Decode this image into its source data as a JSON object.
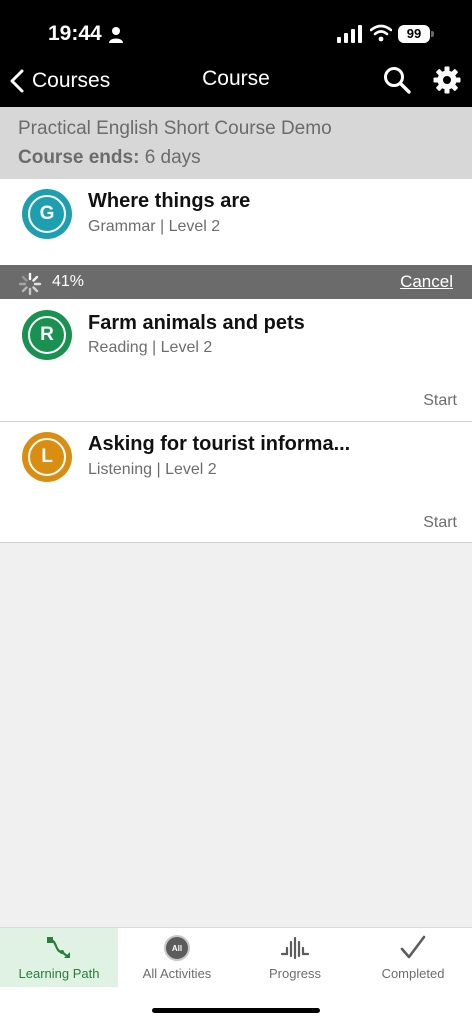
{
  "status_bar": {
    "time": "19:44",
    "battery": "99",
    "icons": [
      "person-icon",
      "signal-icon",
      "wifi-icon",
      "battery-icon"
    ]
  },
  "nav": {
    "back_label": "Courses",
    "title": "Course",
    "icons": [
      "chevron-left-icon",
      "search-icon",
      "gear-icon"
    ]
  },
  "course": {
    "name": "Practical English Short Course Demo",
    "ends_label": "Course ends:",
    "ends_value": "6 days"
  },
  "download": {
    "percent": "41%",
    "cancel_label": "Cancel"
  },
  "activities": [
    {
      "letter": "G",
      "title": "Where things are",
      "subtitle": "Grammar | Level 2",
      "action": "",
      "color": "#1e9fb0"
    },
    {
      "letter": "R",
      "title": "Farm animals and pets",
      "subtitle": "Reading | Level 2",
      "action": "Start",
      "color": "#1a9150"
    },
    {
      "letter": "L",
      "title": "Asking for tourist informa...",
      "subtitle": "Listening | Level 2",
      "action": "Start",
      "color": "#d98e12"
    }
  ],
  "tabs": [
    {
      "label": "Learning Path",
      "icon": "learning-path-icon",
      "active": true
    },
    {
      "label": "All Activities",
      "icon": "all-activities-icon",
      "badge": "All",
      "active": false
    },
    {
      "label": "Progress",
      "icon": "progress-icon",
      "active": false
    },
    {
      "label": "Completed",
      "icon": "checkmark-icon",
      "active": false
    }
  ],
  "colors": {
    "accent_green": "#2a7d3a",
    "header_bg": "#000000",
    "download_bar": "#6b6b6b"
  }
}
